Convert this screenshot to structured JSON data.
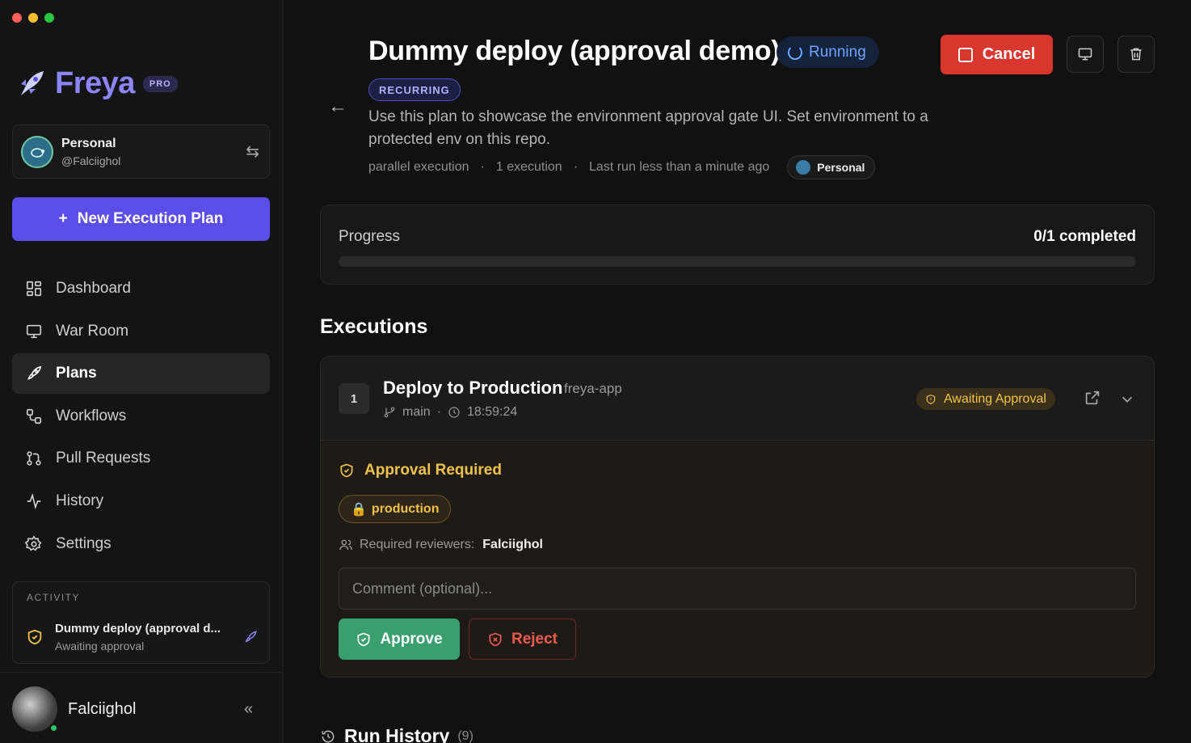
{
  "sidebar": {
    "brand": {
      "name": "Freya",
      "badge": "PRO"
    },
    "account": {
      "name": "Personal",
      "handle": "@Falciighol"
    },
    "new_plan_label": "New Execution Plan",
    "nav": [
      {
        "label": "Dashboard",
        "icon": "grid-icon",
        "active": false
      },
      {
        "label": "War Room",
        "icon": "monitor-icon",
        "active": false
      },
      {
        "label": "Plans",
        "icon": "rocket-icon",
        "active": true
      },
      {
        "label": "Workflows",
        "icon": "workflow-icon",
        "active": false
      },
      {
        "label": "Pull Requests",
        "icon": "pull-request-icon",
        "active": false
      },
      {
        "label": "History",
        "icon": "activity-icon",
        "active": false
      },
      {
        "label": "Settings",
        "icon": "gear-icon",
        "active": false
      }
    ],
    "activity": {
      "label": "ACTIVITY",
      "item_title": "Dummy deploy (approval d...",
      "item_status": "Awaiting approval"
    },
    "user": {
      "name": "Falciighol"
    }
  },
  "plan": {
    "title": "Dummy deploy (approval demo)",
    "status": "Running",
    "tag": "RECURRING",
    "description": "Use this plan to showcase the environment approval gate UI. Set environment to a protected env on this repo.",
    "meta": {
      "mode": "parallel execution",
      "executions": "1 execution",
      "last_run": "Last run less than a minute ago",
      "owner": "Personal"
    },
    "cancel_label": "Cancel"
  },
  "progress": {
    "label": "Progress",
    "count_text": "0/1 completed",
    "fraction": 0
  },
  "executions": {
    "section_title": "Executions",
    "items": [
      {
        "number": "1",
        "name": "Deploy to Production",
        "repo": "freya-app",
        "branch": "main",
        "time": "18:59:24",
        "status": "Awaiting Approval",
        "approval": {
          "title": "Approval Required",
          "environment": "production",
          "reviewers_label": "Required reviewers:",
          "reviewers": "Falciighol",
          "comment_placeholder": "Comment (optional)...",
          "approve_label": "Approve",
          "reject_label": "Reject"
        }
      }
    ]
  },
  "run_history": {
    "title": "Run History",
    "count": "(9)"
  },
  "colors": {
    "accent": "#5b4ee8",
    "brand": "#8b85f7",
    "danger": "#d9372e",
    "success": "#3a9f6e",
    "warning": "#f1c24a",
    "running": "#6aa6ff"
  }
}
